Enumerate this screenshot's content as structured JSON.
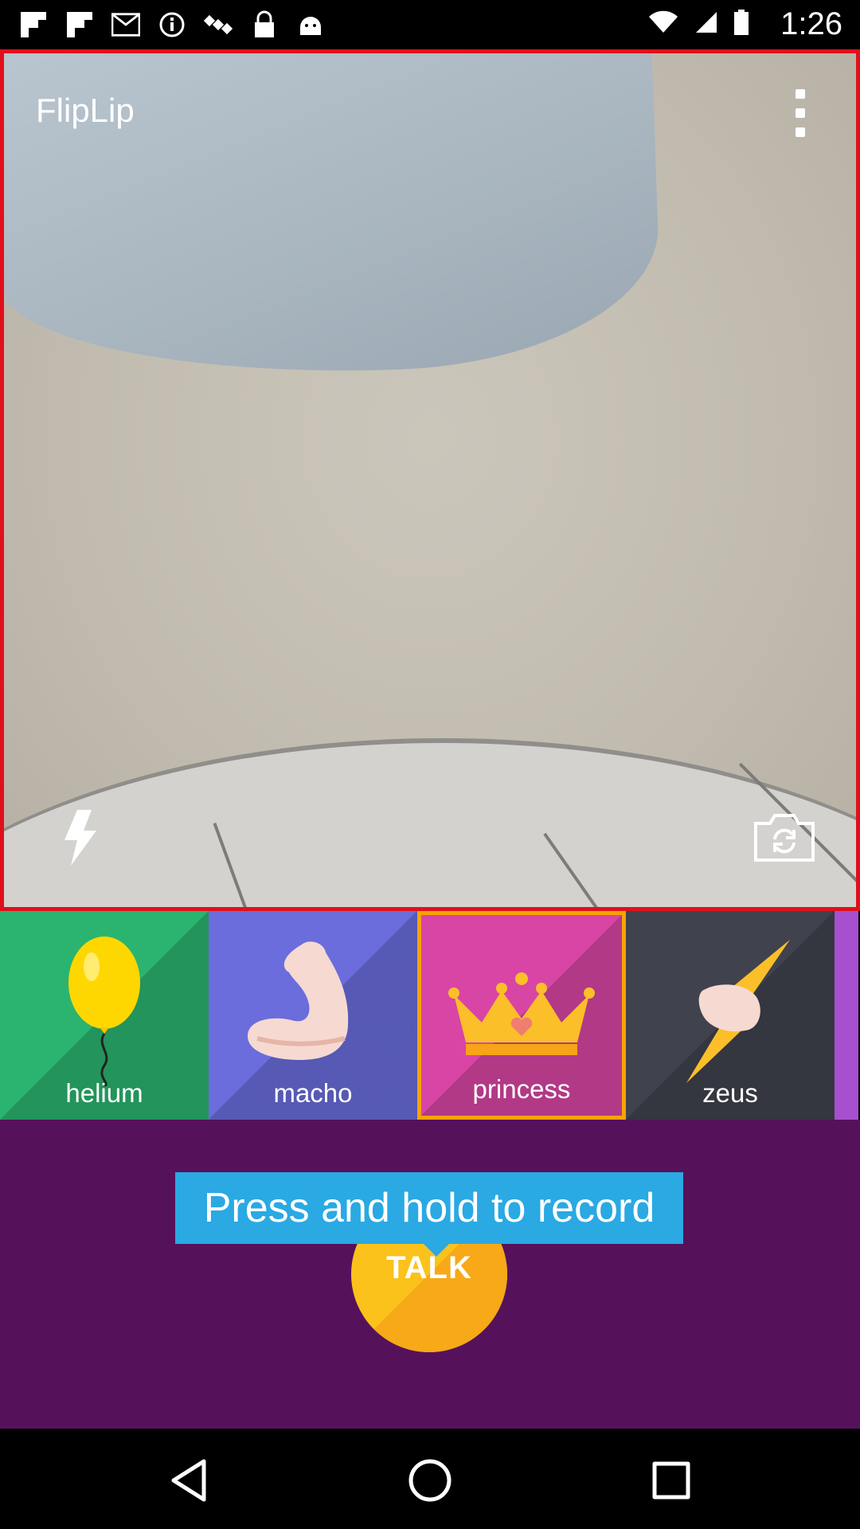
{
  "status_bar": {
    "time": "1:26",
    "icons": [
      "flipboard-icon",
      "flipboard-icon",
      "gmail-icon",
      "info-icon",
      "satellite-icon",
      "lock-icon",
      "android-icon"
    ]
  },
  "app": {
    "title": "FlipLip"
  },
  "camera": {
    "flash_icon": "flash-icon",
    "switch_icon": "switch-camera-icon",
    "border_color": "#e0101a"
  },
  "effects": [
    {
      "label": "helium",
      "color": "#2bb46f"
    },
    {
      "label": "macho",
      "color": "#6a6ddb"
    },
    {
      "label": "princess",
      "color": "#d945a4",
      "selected": true
    },
    {
      "label": "zeus",
      "color": "#40424e"
    }
  ],
  "record": {
    "tooltip": "Press and hold to record",
    "talk_label": "TALK"
  },
  "nav": {
    "back": "back-icon",
    "home": "home-icon",
    "recents": "recents-icon"
  }
}
